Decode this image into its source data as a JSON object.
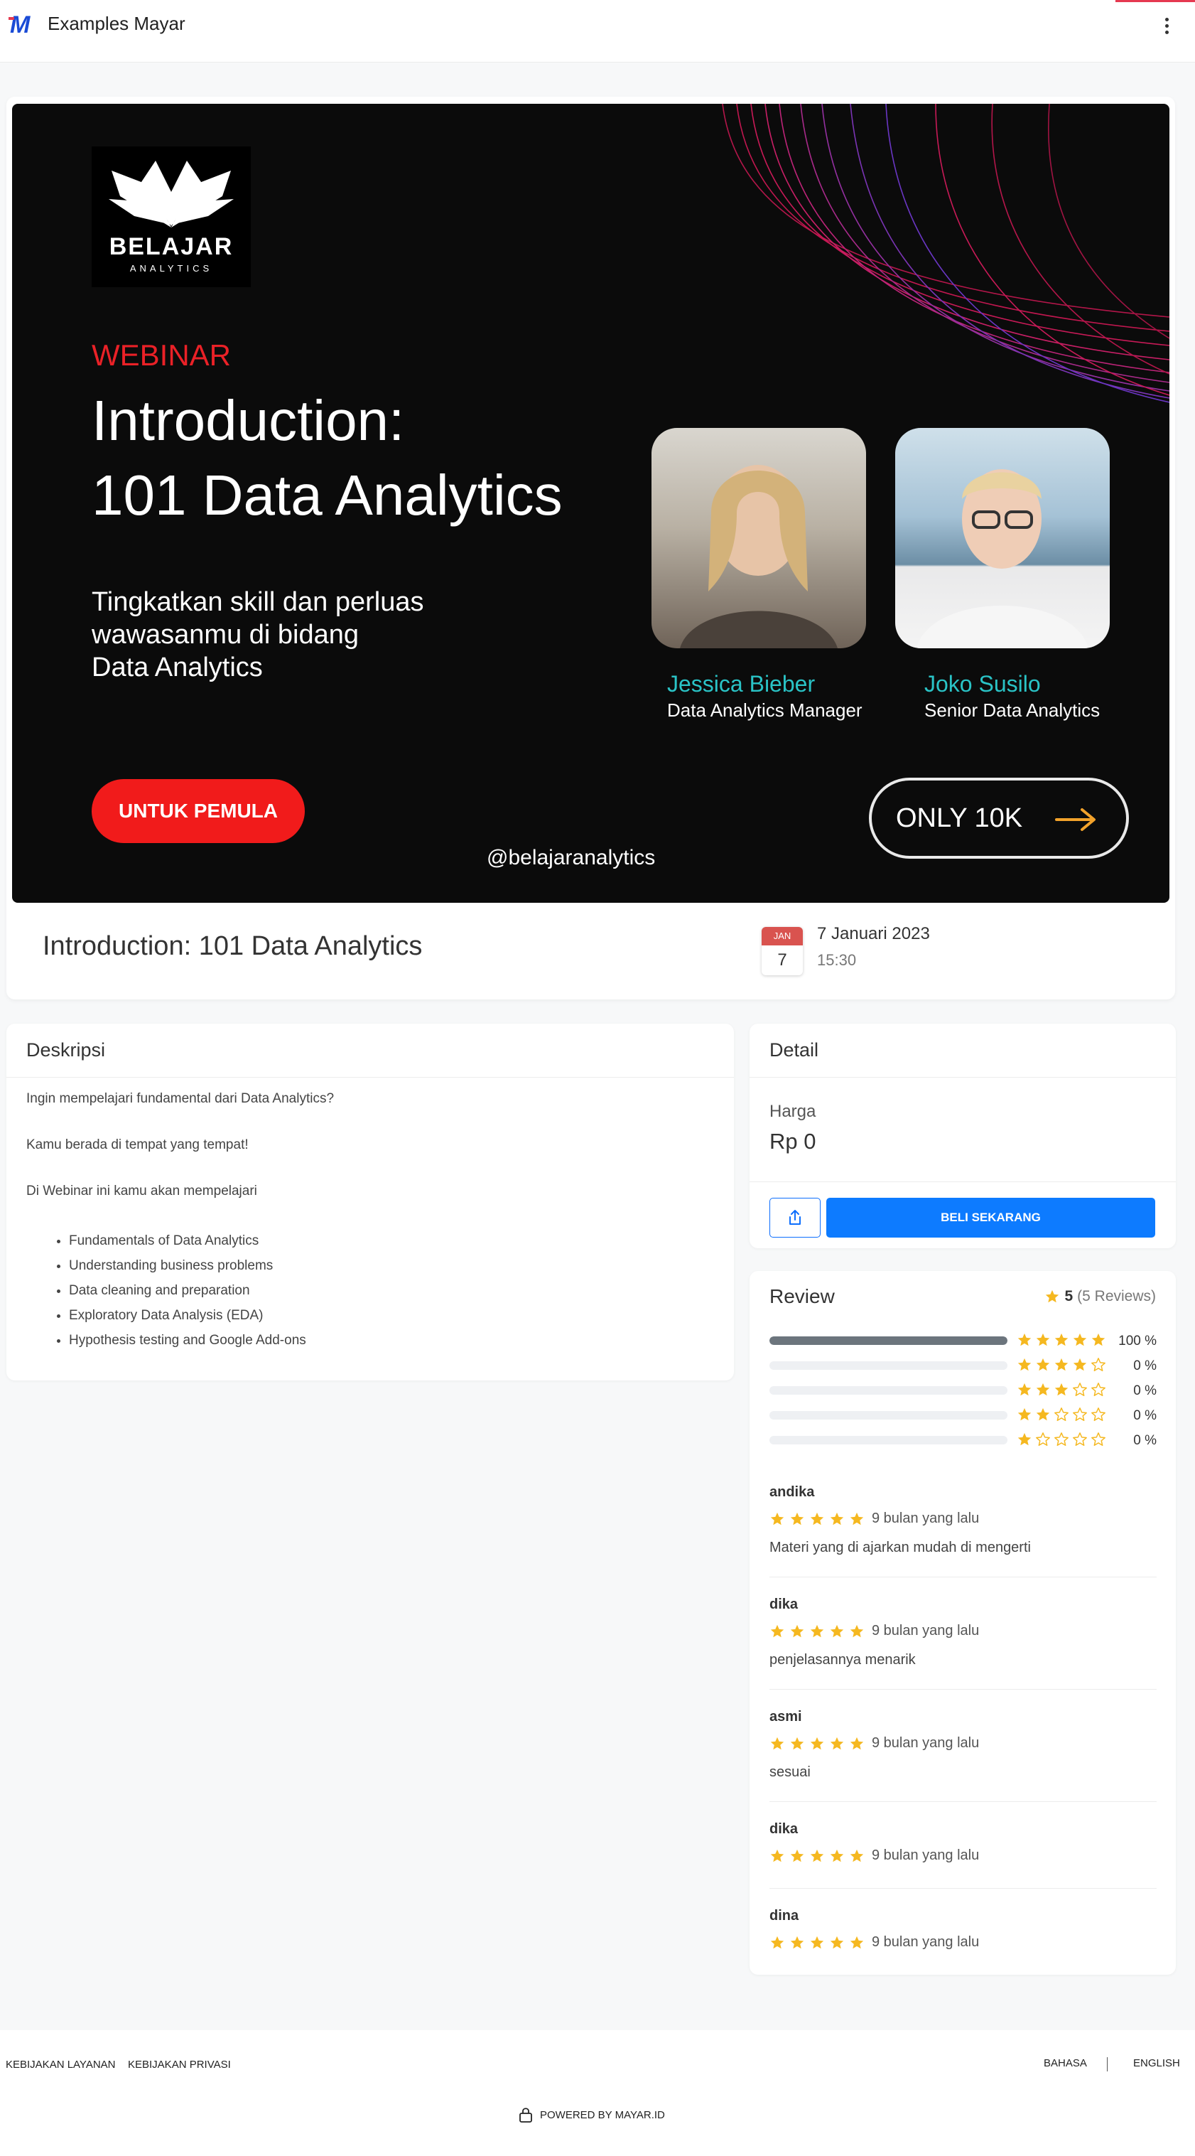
{
  "header": {
    "app_title": "Examples Mayar",
    "logo_letter": "M"
  },
  "banner": {
    "brand_name": "BELAJAR",
    "brand_sub": "ANALYTICS",
    "label": "WEBINAR",
    "title_line1": "Introduction:",
    "title_line2": "101 Data Analytics",
    "tagline_line1": "Tingkatkan skill dan perluas",
    "tagline_line2": "wawasanmu di bidang",
    "tagline_line3": "Data Analytics",
    "level_button": "UNTUK PEMULA",
    "handle": "@belajaranalytics",
    "price_button": "ONLY 10K",
    "speakers": [
      {
        "name": "Jessica Bieber",
        "role": "Data Analytics Manager"
      },
      {
        "name": "Joko Susilo",
        "role": "Senior Data Analytics"
      }
    ]
  },
  "event": {
    "title": "Introduction: 101 Data Analytics",
    "month": "JAN",
    "day": "7",
    "date": "7 Januari 2023",
    "time": "15:30"
  },
  "description": {
    "heading": "Deskripsi",
    "paragraphs": [
      " Ingin mempelajari fundamental dari Data Analytics?",
      "Kamu berada di tempat yang tempat!",
      "Di Webinar ini kamu akan mempelajari"
    ],
    "items": [
      " Fundamentals of Data Analytics",
      "Understanding business problems",
      "Data cleaning and preparation",
      "Exploratory Data Analysis (EDA)",
      "Hypothesis testing and Google Add-ons"
    ]
  },
  "detail": {
    "heading": "Detail",
    "price_label": "Harga",
    "price_value": "Rp 0",
    "buy_label": "BELI SEKARANG"
  },
  "review": {
    "heading": "Review",
    "average": "5",
    "count_label": "(5 Reviews)",
    "distribution": [
      {
        "stars": 5,
        "fraction": 1.0,
        "pct_label": "100 %"
      },
      {
        "stars": 4,
        "fraction": 0,
        "pct_label": "0 %"
      },
      {
        "stars": 3,
        "fraction": 0,
        "pct_label": "0 %"
      },
      {
        "stars": 2,
        "fraction": 0,
        "pct_label": "0 %"
      },
      {
        "stars": 1,
        "fraction": 0,
        "pct_label": "0 %"
      }
    ],
    "items": [
      {
        "name": "andika",
        "rating": 5,
        "time": "9 bulan yang lalu",
        "comment": "Materi yang di ajarkan mudah di mengerti"
      },
      {
        "name": "dika",
        "rating": 5,
        "time": "9 bulan yang lalu",
        "comment": "penjelasannya menarik"
      },
      {
        "name": "asmi",
        "rating": 5,
        "time": "9 bulan yang lalu",
        "comment": "sesuai"
      },
      {
        "name": "dika",
        "rating": 5,
        "time": "9 bulan yang lalu",
        "comment": ""
      },
      {
        "name": "dina",
        "rating": 5,
        "time": "9 bulan yang lalu",
        "comment": ""
      }
    ]
  },
  "footer": {
    "terms": "KEBIJAKAN LAYANAN",
    "privacy": "KEBIJAKAN PRIVASI",
    "language_label": "BAHASA",
    "language_value": "ENGLISH",
    "powered": "POWERED BY MAYAR.ID"
  },
  "colors": {
    "star": "#f5b820",
    "primary": "#0d7bff",
    "accent_red": "#e53950"
  }
}
